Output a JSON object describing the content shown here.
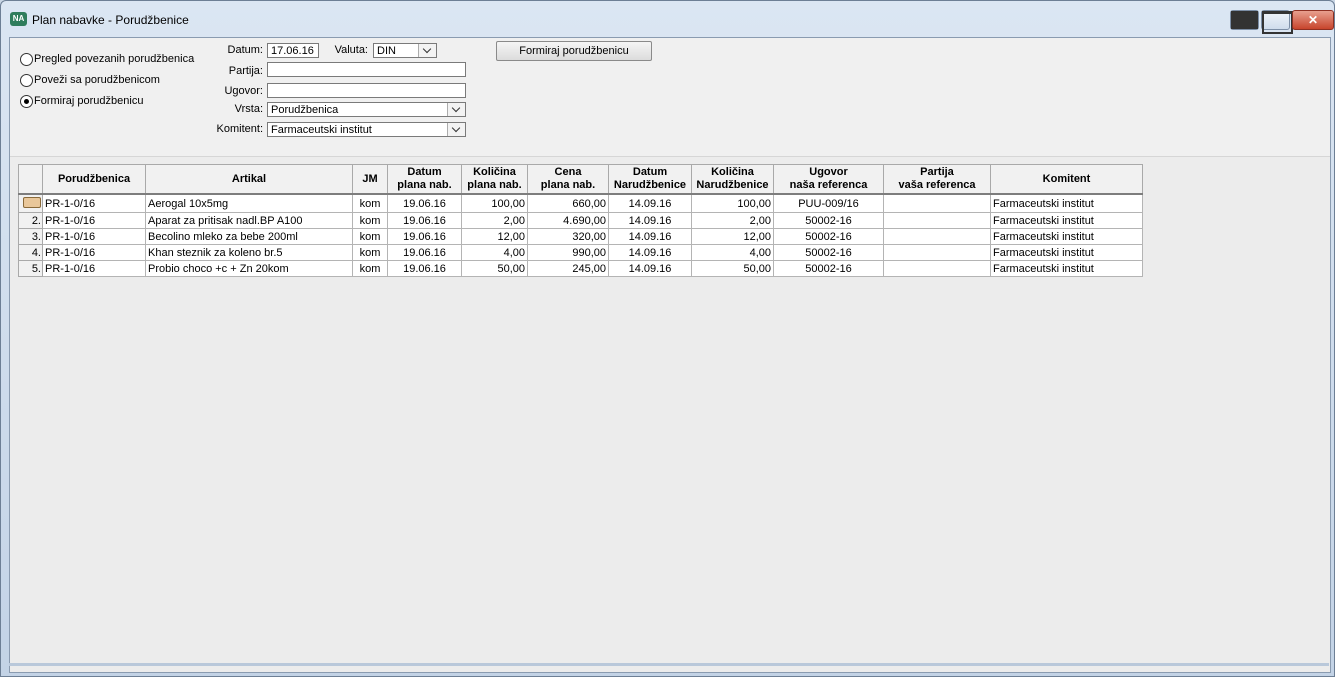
{
  "window": {
    "icon": "app-logo-icon",
    "title": "Plan nabavke - Porudžbenice",
    "controls": [
      "minimize-icon",
      "maximize-icon",
      "close-icon"
    ]
  },
  "options": [
    {
      "label": "Pregled povezanih porudžbenica",
      "selected": false
    },
    {
      "label": "Poveži sa porudžbenicom",
      "selected": false
    },
    {
      "label": "Formiraj porudžbenicu",
      "selected": true
    }
  ],
  "form": {
    "datum_label": "Datum:",
    "datum_value": "17.06.16",
    "valuta_label": "Valuta:",
    "valuta_value": "DIN",
    "partija_label": "Partija:",
    "partija_value": "",
    "ugovor_label": "Ugovor:",
    "ugovor_value": "",
    "vrsta_label": "Vrsta:",
    "vrsta_value": "Porudžbenica",
    "komitent_label": "Komitent:",
    "komitent_value": "Farmaceutski institut"
  },
  "action_button": "Formiraj porudžbenicu",
  "grid": {
    "columns": [
      {
        "line1": "Porudžbenica",
        "line2": ""
      },
      {
        "line1": "Artikal",
        "line2": ""
      },
      {
        "line1": "JM",
        "line2": ""
      },
      {
        "line1": "Datum",
        "line2": "plana nab."
      },
      {
        "line1": "Količina",
        "line2": "plana nab."
      },
      {
        "line1": "Cena",
        "line2": "plana nab."
      },
      {
        "line1": "Datum",
        "line2": "Narudžbenice"
      },
      {
        "line1": "Količina",
        "line2": "Narudžbenice"
      },
      {
        "line1": "Ugovor",
        "line2": "naša referenca"
      },
      {
        "line1": "Partija",
        "line2": "vaša referenca"
      },
      {
        "line1": "Komitent",
        "line2": ""
      }
    ],
    "current_row_icon": "pointing-hand-icon",
    "rows": [
      {
        "num": "",
        "porudzbenica": "PR-1-0/16",
        "artikal": "Aerogal 10x5mg",
        "jm": "kom",
        "datum_plana": "19.06.16",
        "kolicina_plana": "100,00",
        "cena_plana": "660,00",
        "datum_nar": "14.09.16",
        "kolicina_nar": "100,00",
        "ugovor": "PUU-009/16",
        "partija": "",
        "komitent": "Farmaceutski institut"
      },
      {
        "num": "2.",
        "porudzbenica": "PR-1-0/16",
        "artikal": "Aparat za pritisak nadl.BP A100",
        "jm": "kom",
        "datum_plana": "19.06.16",
        "kolicina_plana": "2,00",
        "cena_plana": "4.690,00",
        "datum_nar": "14.09.16",
        "kolicina_nar": "2,00",
        "ugovor": "50002-16",
        "partija": "",
        "komitent": "Farmaceutski institut"
      },
      {
        "num": "3.",
        "porudzbenica": "PR-1-0/16",
        "artikal": "Becolino mleko za bebe 200ml",
        "jm": "kom",
        "datum_plana": "19.06.16",
        "kolicina_plana": "12,00",
        "cena_plana": "320,00",
        "datum_nar": "14.09.16",
        "kolicina_nar": "12,00",
        "ugovor": "50002-16",
        "partija": "",
        "komitent": "Farmaceutski institut"
      },
      {
        "num": "4.",
        "porudzbenica": "PR-1-0/16",
        "artikal": "Khan steznik za koleno br.5",
        "jm": "kom",
        "datum_plana": "19.06.16",
        "kolicina_plana": "4,00",
        "cena_plana": "990,00",
        "datum_nar": "14.09.16",
        "kolicina_nar": "4,00",
        "ugovor": "50002-16",
        "partija": "",
        "komitent": "Farmaceutski institut"
      },
      {
        "num": "5.",
        "porudzbenica": "PR-1-0/16",
        "artikal": "Probio choco +c + Zn 20kom",
        "jm": "kom",
        "datum_plana": "19.06.16",
        "kolicina_plana": "50,00",
        "cena_plana": "245,00",
        "datum_nar": "14.09.16",
        "kolicina_nar": "50,00",
        "ugovor": "50002-16",
        "partija": "",
        "komitent": "Farmaceutski institut"
      }
    ]
  }
}
